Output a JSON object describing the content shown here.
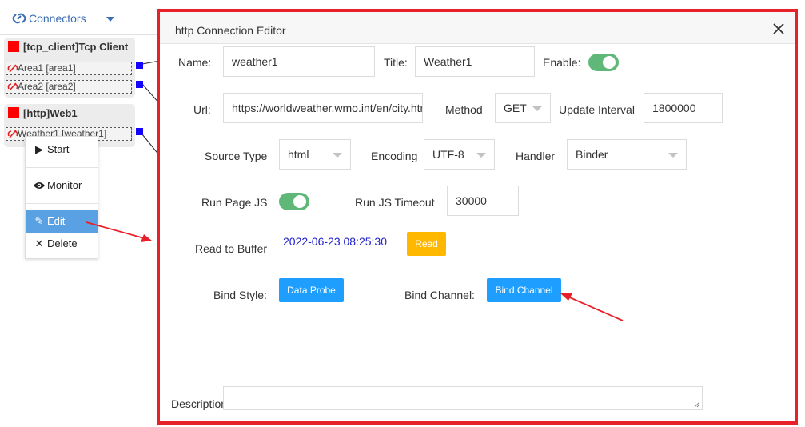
{
  "left_panel": {
    "header_title": "Connectors",
    "nodes": [
      {
        "title": "[tcp_client]Tcp Client",
        "areas": [
          "Area1 [area1]",
          "Area2 [area2]"
        ]
      },
      {
        "title": "[http]Web1",
        "areas": [
          "Weather1 [weather1]"
        ]
      }
    ],
    "context_menu": {
      "start": "Start",
      "monitor": "Monitor",
      "edit": "Edit",
      "delete": "Delete"
    }
  },
  "dialog": {
    "title": "http Connection Editor",
    "name_label": "Name:",
    "name_value": "weather1",
    "title_label": "Title:",
    "title_value": "Weather1",
    "enable_label": "Enable:",
    "enable_on": true,
    "url_label": "Url:",
    "url_value": "https://worldweather.wmo.int/en/city.html",
    "method_label": "Method",
    "method_value": "GET",
    "update_interval_label": "Update Interval",
    "update_interval_value": "1800000",
    "source_type_label": "Source Type",
    "source_type_value": "html",
    "encoding_label": "Encoding",
    "encoding_value": "UTF-8",
    "handler_label": "Handler",
    "handler_value": "Binder",
    "run_page_js_label": "Run Page JS",
    "run_page_js_on": true,
    "run_js_timeout_label": "Run JS Timeout",
    "run_js_timeout_value": "30000",
    "read_to_buffer_label": "Read to Buffer",
    "read_timestamp": "2022-06-23 08:25:30",
    "read_button": "Read",
    "bind_style_label": "Bind Style:",
    "data_probe_button": "Data Probe",
    "bind_channel_label": "Bind Channel:",
    "bind_channel_button": "Bind Channel",
    "description_label": "Description",
    "description_value": ""
  },
  "colors": {
    "frame_red": "#e8202a",
    "toggle_green": "#5fb878",
    "button_blue": "#1e9fff",
    "button_yellow": "#ffb800",
    "menu_active": "#5aa1e3",
    "port_blue": "#1400ff",
    "timestamp_blue": "#2222cc"
  }
}
